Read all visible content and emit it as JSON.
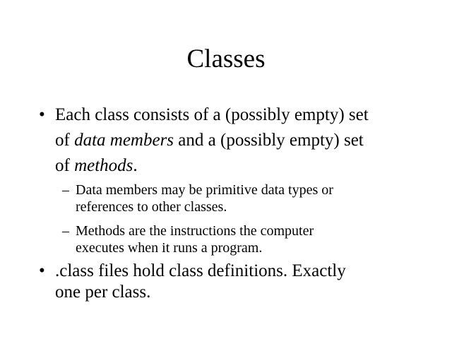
{
  "slide": {
    "title": "Classes",
    "bullets": [
      {
        "marker": "•",
        "lines": [
          "Each class consists of a (possibly empty) set",
          "of ",
          "data members",
          " and a (possibly empty) set",
          "of ",
          "methods",
          "."
        ]
      },
      {
        "marker": "•",
        "lines": [
          ".class files hold class definitions.  Exactly",
          "one per class."
        ]
      }
    ],
    "sub_bullets": [
      {
        "marker": "–",
        "lines": [
          "Data members may be primitive data types or",
          "references to other classes."
        ]
      },
      {
        "marker": "–",
        "lines": [
          "Methods are the instructions the computer",
          "executes when it runs a program."
        ]
      }
    ]
  }
}
